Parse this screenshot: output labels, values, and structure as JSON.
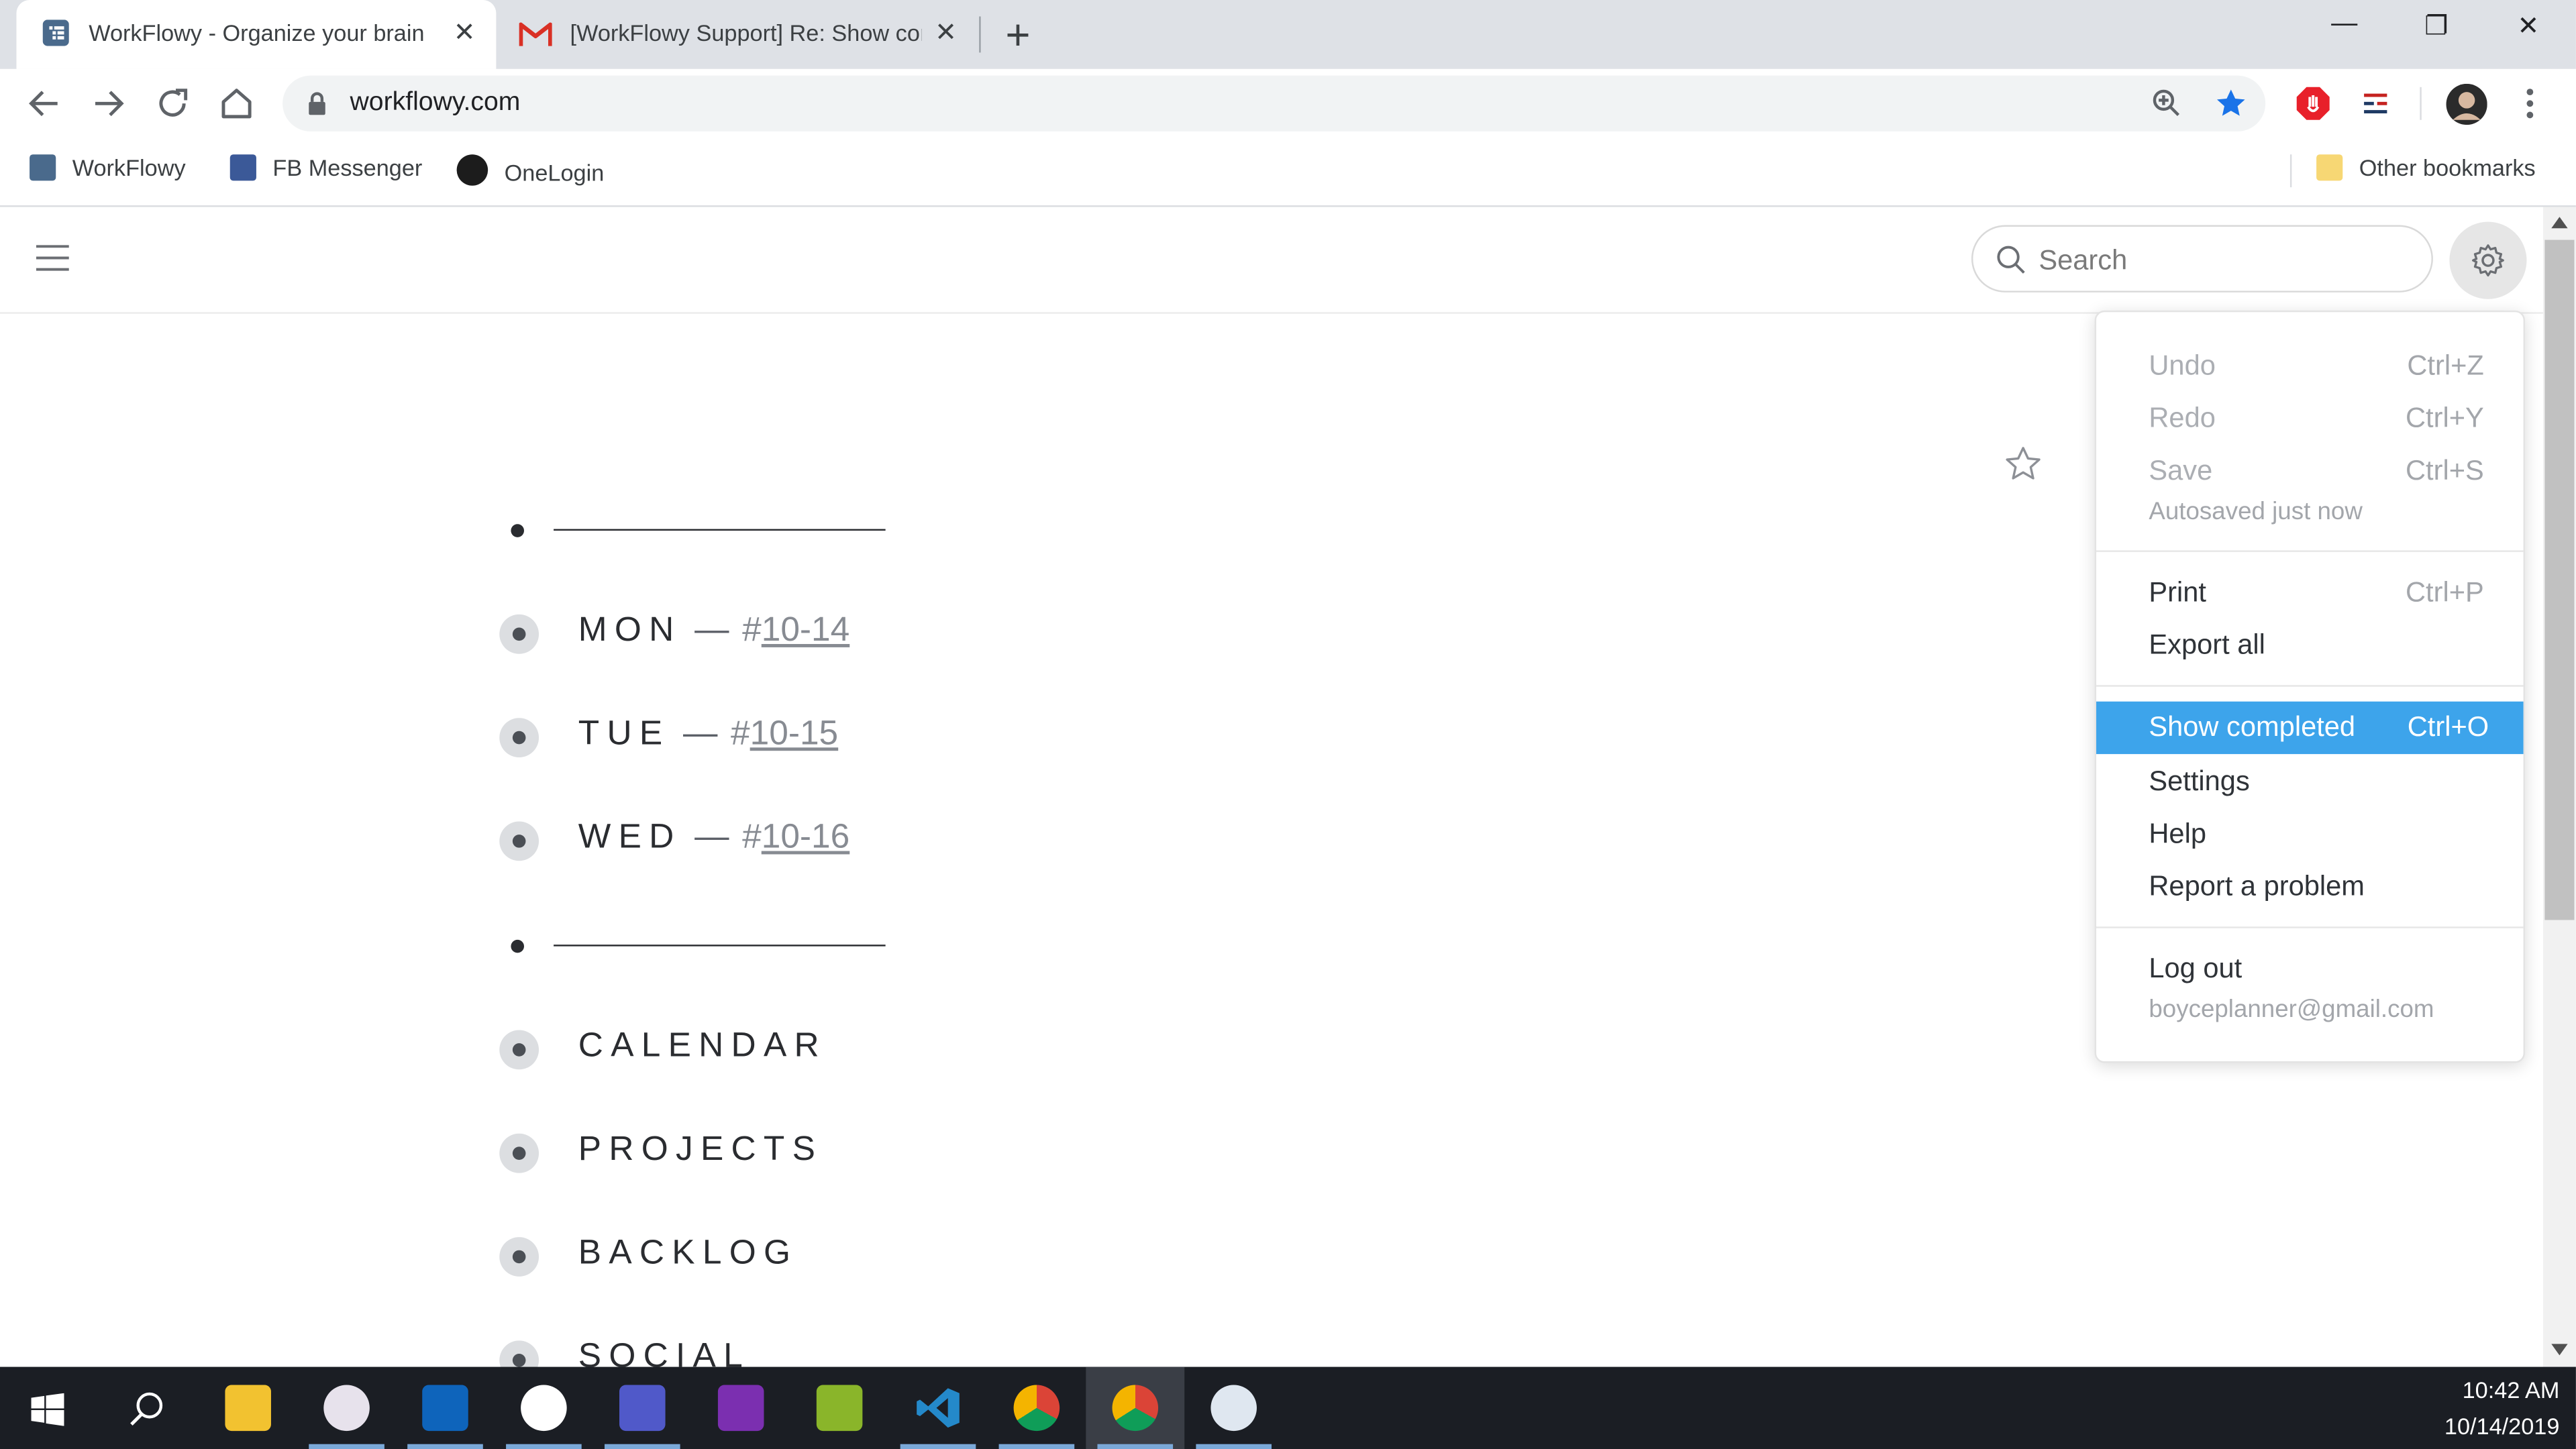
{
  "browser": {
    "tabs": [
      {
        "title": "WorkFlowy - Organize your brain",
        "active": true,
        "icon": "workflowy-icon"
      },
      {
        "title": "[WorkFlowy Support] Re: Show completed",
        "active": false,
        "icon": "gmail-icon"
      }
    ],
    "new_tab": "+",
    "window_controls": {
      "minimize": "—",
      "restore": "❐",
      "close": "✕"
    },
    "url": "workflowy.com",
    "bookmarks": [
      {
        "label": "WorkFlowy",
        "icon": "workflowy-icon"
      },
      {
        "label": "FB Messenger",
        "icon": "facebook-icon"
      },
      {
        "label": "OneLogin",
        "icon": "onelogin-icon"
      }
    ],
    "other_bookmarks": "Other bookmarks"
  },
  "app": {
    "search_placeholder": "Search",
    "outline": [
      {
        "type": "divider"
      },
      {
        "type": "item",
        "text": "MON",
        "sep": "—",
        "hash": "#",
        "tag": "10-14"
      },
      {
        "type": "item",
        "text": "TUE",
        "sep": "—",
        "hash": "#",
        "tag": "10-15"
      },
      {
        "type": "item",
        "text": "WED",
        "sep": "—",
        "hash": "#",
        "tag": "10-16"
      },
      {
        "type": "divider"
      },
      {
        "type": "item",
        "text": "CALENDAR"
      },
      {
        "type": "item",
        "text": "PROJECTS"
      },
      {
        "type": "item",
        "text": "BACKLOG"
      },
      {
        "type": "item",
        "text": "SOCIAL"
      }
    ]
  },
  "menu": {
    "undo": {
      "label": "Undo",
      "shortcut": "Ctrl+Z"
    },
    "redo": {
      "label": "Redo",
      "shortcut": "Ctrl+Y"
    },
    "save": {
      "label": "Save",
      "shortcut": "Ctrl+S"
    },
    "save_status": "Autosaved just now",
    "print": {
      "label": "Print",
      "shortcut": "Ctrl+P"
    },
    "export": {
      "label": "Export all"
    },
    "show_completed": {
      "label": "Show completed",
      "shortcut": "Ctrl+O"
    },
    "settings": {
      "label": "Settings"
    },
    "help": {
      "label": "Help"
    },
    "report": {
      "label": "Report a problem"
    },
    "logout": {
      "label": "Log out"
    },
    "email": "boyceplanner@gmail.com"
  },
  "taskbar": {
    "apps": [
      "start-icon",
      "search-icon",
      "file-explorer-icon",
      "snipping-tool-icon",
      "outlook-icon",
      "slack-icon",
      "teams-icon",
      "onenote-icon",
      "lambda-app-icon",
      "vscode-icon",
      "chrome-profile-icon",
      "chrome-icon",
      "paint-icon"
    ],
    "time": "10:42 AM",
    "date": "10/14/2019"
  },
  "colors": {
    "highlight": "#3da4eb",
    "tabstrip": "#dee1e6",
    "taskbar": "#1b1e24"
  }
}
